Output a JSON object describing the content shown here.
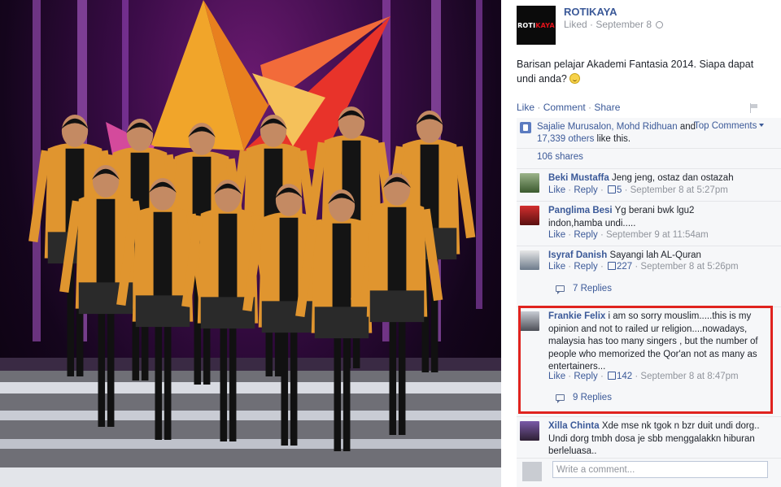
{
  "post": {
    "page_name": "ROTIKAYA",
    "logo_text_white": "ROTI",
    "logo_text_red": "KAYA",
    "meta_liked": "Liked",
    "meta_sep": " · ",
    "meta_date": "September 8",
    "caption": "Barisan pelajar Akademi Fantasia 2014. Siapa dapat undi anda?"
  },
  "actions": {
    "like": "Like",
    "comment": "Comment",
    "share": "Share",
    "sep": " · "
  },
  "likes": {
    "names": "Sajalie Murusalon, Mohd Ridhuan",
    "and": "and",
    "others": "17,339 others",
    "suffix": "like this.",
    "sort": "Top Comments"
  },
  "shares": "106 shares",
  "comments": [
    {
      "author": "Beki Mustaffa",
      "text": "Jeng jeng, ostaz dan ostazah",
      "like": "Like",
      "reply": "Reply",
      "likes": "5",
      "time": "September 8 at 5:27pm"
    },
    {
      "author": "Panglima Besi",
      "text": "Yg berani bwk lgu2 indon,hamba undi.....",
      "like": "Like",
      "reply": "Reply",
      "time": "September 9 at 11:54am"
    },
    {
      "author": "Isyraf Danish",
      "text": "Sayangi lah AL-Quran",
      "like": "Like",
      "reply": "Reply",
      "likes": "227",
      "time": "September 8 at 5:26pm",
      "replies": "7 Replies"
    },
    {
      "author": "Frankie Felix",
      "text": "i am so sorry mouslim.....this is my opinion and not to railed ur religion....nowadays, malaysia has too many singers , but the number of people who memorized the Qor'an not as many as entertainers...",
      "like": "Like",
      "reply": "Reply",
      "likes": "142",
      "time": "September 8 at 8:47pm",
      "replies": "9 Replies"
    },
    {
      "author": "Xilla Chinta",
      "text": "Xde mse nk tgok n bzr duit undi dorg.. Undi dorg tmbh dosa je sbb menggalakkn hiburan berleluasa.."
    }
  ],
  "composer": {
    "placeholder": "Write a comment..."
  },
  "colors": {
    "link": "#3b5998",
    "highlight": "#e0231f",
    "jacket": "#e0952f"
  }
}
